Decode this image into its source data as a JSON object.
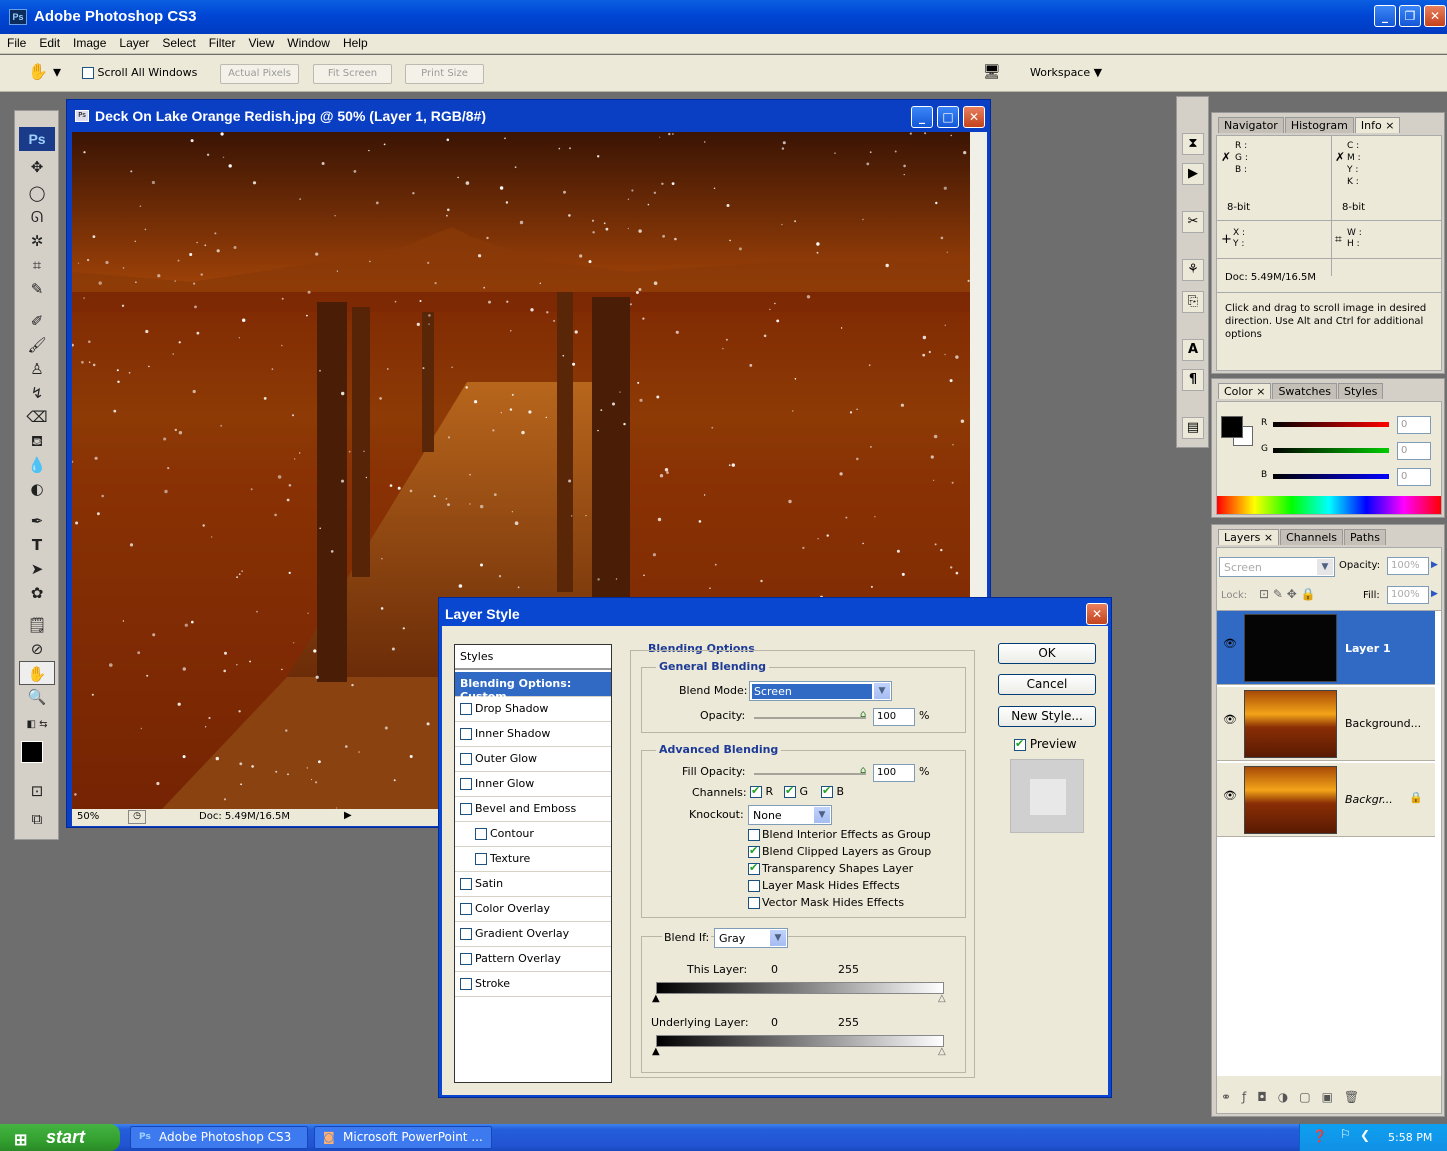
{
  "app": {
    "title": "Adobe Photoshop CS3",
    "icon_text": "Ps"
  },
  "menu": [
    "File",
    "Edit",
    "Image",
    "Layer",
    "Select",
    "Filter",
    "View",
    "Window",
    "Help"
  ],
  "options": {
    "scroll_all": "Scroll All Windows",
    "actual_pixels": "Actual Pixels",
    "fit_screen": "Fit Screen",
    "print_size": "Print Size",
    "workspace": "Workspace ▼"
  },
  "document": {
    "title": "Deck On Lake Orange Redish.jpg @ 50% (Layer 1, RGB/8#)",
    "zoom": "50%",
    "doc_size": "Doc: 5.49M/16.5M"
  },
  "info_panel": {
    "tabs": [
      "Navigator",
      "Histogram",
      "Info"
    ],
    "rgb": "R :\nG :\nB :",
    "cmyk": "C :\nM :\nY :\nK :",
    "bit_left": "8-bit",
    "bit_right": "8-bit",
    "xy": "X :\nY :",
    "wh": "W :\nH :",
    "doc": "Doc: 5.49M/16.5M",
    "hint": "Click and drag to scroll image in desired direction.  Use Alt and Ctrl for additional options"
  },
  "color_panel": {
    "tabs": [
      "Color",
      "Swatches",
      "Styles"
    ],
    "r_label": "R",
    "g_label": "G",
    "b_label": "B",
    "r": "0",
    "g": "0",
    "b": "0"
  },
  "layers_panel": {
    "tabs": [
      "Layers",
      "Channels",
      "Paths"
    ],
    "blend": "Screen",
    "opacity_label": "Opacity:",
    "opacity": "100%",
    "lock_label": "Lock:",
    "fill_label": "Fill:",
    "fill": "100%",
    "layers": [
      "Layer 1",
      "Background...",
      "Backgr..."
    ]
  },
  "dialog": {
    "title": "Layer Style",
    "styles_header": "Styles",
    "selected": "Blending Options: Custom",
    "effects": [
      "Drop Shadow",
      "Inner Shadow",
      "Outer Glow",
      "Inner Glow",
      "Bevel and Emboss",
      "Contour",
      "Texture",
      "Satin",
      "Color Overlay",
      "Gradient Overlay",
      "Pattern Overlay",
      "Stroke"
    ],
    "blending_options": "Blending Options",
    "general_blending": "General Blending",
    "blend_mode_label": "Blend Mode:",
    "blend_mode": "Screen",
    "opacity_label": "Opacity:",
    "opacity": "100",
    "pct": "%",
    "advanced_blending": "Advanced Blending",
    "fill_opacity_label": "Fill Opacity:",
    "fill_opacity": "100",
    "channels_label": "Channels:",
    "ch_r": "R",
    "ch_g": "G",
    "ch_b": "B",
    "knockout_label": "Knockout:",
    "knockout": "None",
    "checks": [
      "Blend Interior Effects as Group",
      "Blend Clipped Layers as Group",
      "Transparency Shapes Layer",
      "Layer Mask Hides Effects",
      "Vector Mask Hides Effects"
    ],
    "checks_state": [
      false,
      true,
      true,
      false,
      false
    ],
    "blend_if_label": "Blend If:",
    "blend_if": "Gray",
    "this_layer_label": "This Layer:",
    "this_min": "0",
    "this_max": "255",
    "underlying_label": "Underlying Layer:",
    "under_min": "0",
    "under_max": "255",
    "ok": "OK",
    "cancel": "Cancel",
    "new_style": "New Style...",
    "preview": "Preview"
  },
  "taskbar": {
    "start": "start",
    "tasks": [
      "Adobe Photoshop CS3",
      "Microsoft PowerPoint ..."
    ],
    "time": "5:58 PM"
  },
  "colors": {
    "xp_blue": "#0a47d1",
    "selection": "#316ac5",
    "panel": "#d4d0c8"
  }
}
